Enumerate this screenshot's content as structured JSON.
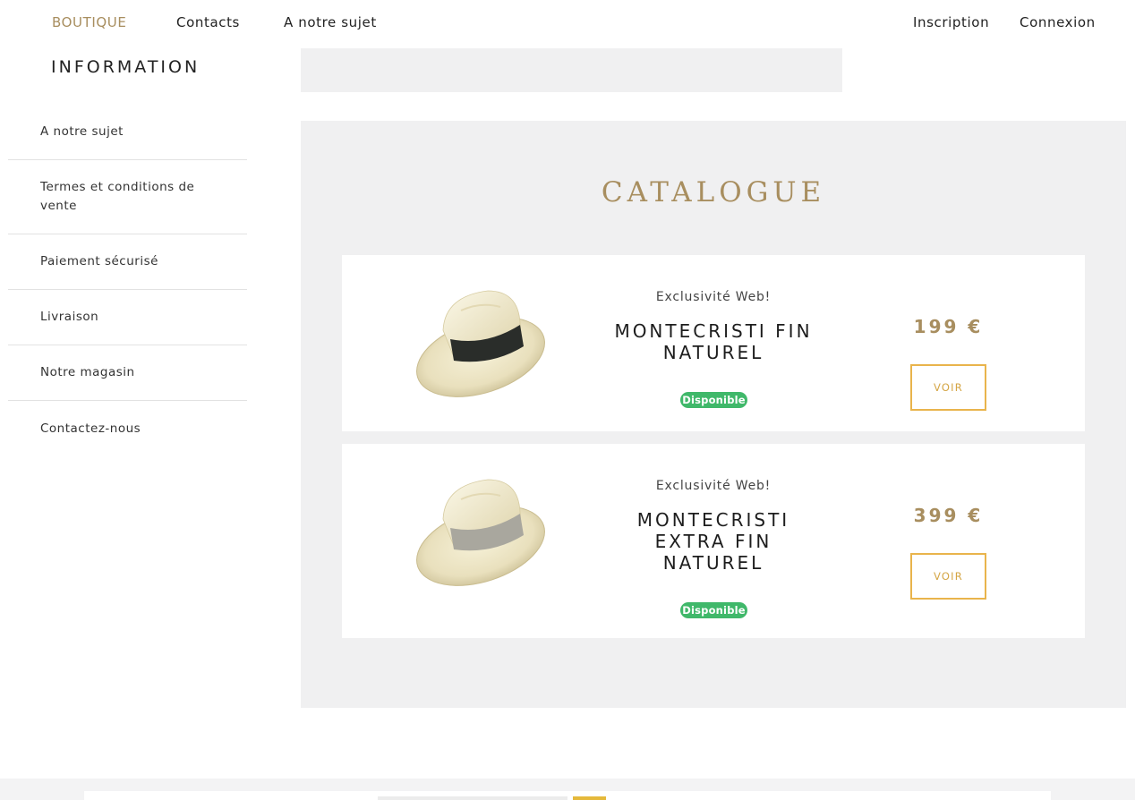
{
  "nav": {
    "left": [
      "BOUTIQUE",
      "Contacts",
      "A notre sujet"
    ],
    "right": [
      "Inscription",
      "Connexion"
    ],
    "active": "BOUTIQUE"
  },
  "sidebar": {
    "title": "INFORMATION",
    "items": [
      {
        "label": "A notre sujet"
      },
      {
        "label": "Termes et conditions de vente"
      },
      {
        "label": "Paiement sécurisé"
      },
      {
        "label": "Livraison"
      },
      {
        "label": "Notre magasin"
      },
      {
        "label": "Contactez-nous"
      }
    ]
  },
  "catalogue": {
    "title": "CATALOGUE",
    "products": [
      {
        "tag": "Exclusivité Web!",
        "name": "MONTECRISTI FIN NATUREL",
        "availability": "Disponible",
        "price": "199 €",
        "button": "VOIR",
        "band_color": "#2a2d2a"
      },
      {
        "tag": "Exclusivité Web!",
        "name": "MONTECRISTI EXTRA FIN NATUREL",
        "availability": "Disponible",
        "price": "399 €",
        "button": "VOIR",
        "band_color": "#a9a79e"
      }
    ]
  },
  "colors": {
    "accent_gold": "#a88e5f",
    "button_border": "#e9b44c",
    "badge_green": "#40b86a",
    "panel_grey": "#f0f0f1"
  }
}
